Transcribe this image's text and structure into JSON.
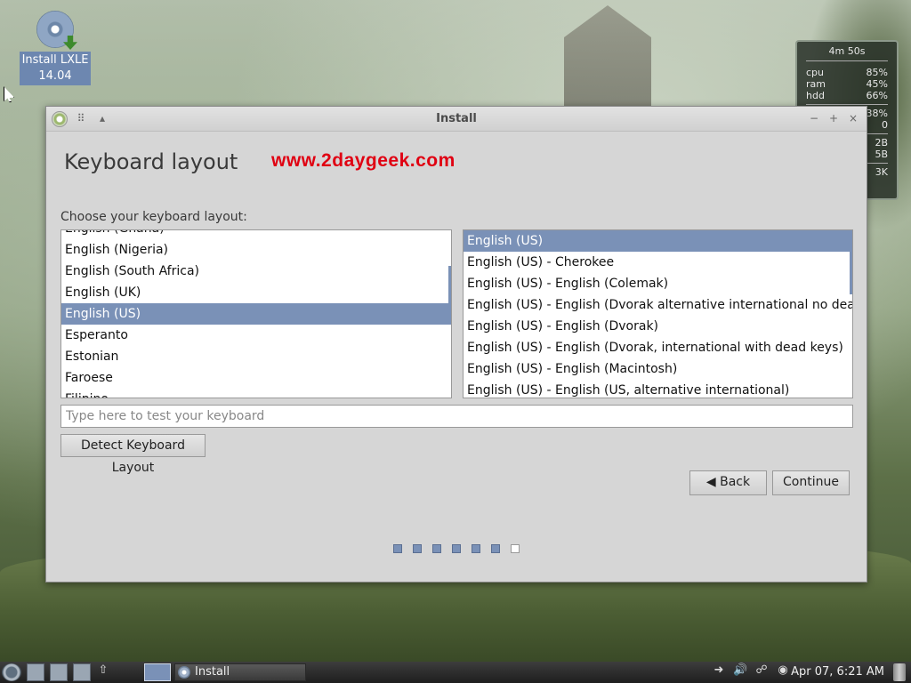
{
  "desktop": {
    "icon_label_line1": "Install LXLE",
    "icon_label_line2": "14.04"
  },
  "monitor": {
    "uptime": "4m 50s",
    "rows": [
      {
        "label": "cpu",
        "value": "85%"
      },
      {
        "label": "ram",
        "value": "45%"
      },
      {
        "label": "hdd",
        "value": "66%"
      }
    ],
    "extra": [
      "38%",
      "0",
      "2B",
      "5B",
      "3K"
    ]
  },
  "window": {
    "title": "Install",
    "controls": {
      "minimize": "−",
      "maximize": "+",
      "close": "×"
    }
  },
  "page": {
    "heading": "Keyboard layout",
    "watermark": "www.2daygeek.com",
    "prompt": "Choose your keyboard layout:"
  },
  "layouts": [
    {
      "label": "English (Ghana)",
      "selected": false
    },
    {
      "label": "English (Nigeria)",
      "selected": false
    },
    {
      "label": "English (South Africa)",
      "selected": false
    },
    {
      "label": "English (UK)",
      "selected": false
    },
    {
      "label": "English (US)",
      "selected": true
    },
    {
      "label": "Esperanto",
      "selected": false
    },
    {
      "label": "Estonian",
      "selected": false
    },
    {
      "label": "Faroese",
      "selected": false
    },
    {
      "label": "Filipino",
      "selected": false
    }
  ],
  "variants": [
    {
      "label": "English (US)",
      "selected": true
    },
    {
      "label": "English (US) - Cherokee",
      "selected": false
    },
    {
      "label": "English (US) - English (Colemak)",
      "selected": false
    },
    {
      "label": "English (US) - English (Dvorak alternative international no dead keys)",
      "selected": false
    },
    {
      "label": "English (US) - English (Dvorak)",
      "selected": false
    },
    {
      "label": "English (US) - English (Dvorak, international with dead keys)",
      "selected": false
    },
    {
      "label": "English (US) - English (Macintosh)",
      "selected": false
    },
    {
      "label": "English (US) - English (US, alternative international)",
      "selected": false
    }
  ],
  "test_input": {
    "placeholder": "Type here to test your keyboard",
    "value": ""
  },
  "buttons": {
    "detect": "Detect Keyboard Layout",
    "back": "Back",
    "back_icon": "◀",
    "continue": "Continue"
  },
  "progress": {
    "total_steps": 7,
    "completed_steps": 6
  },
  "taskbar": {
    "task_label": "Install",
    "clock": "Apr 07,   6:21 AM",
    "tray_icons": [
      "arrow-right-icon",
      "volume-icon",
      "network-icon",
      "update-icon"
    ]
  },
  "colors": {
    "selection": "#7a91b7",
    "watermark": "#e00012"
  }
}
